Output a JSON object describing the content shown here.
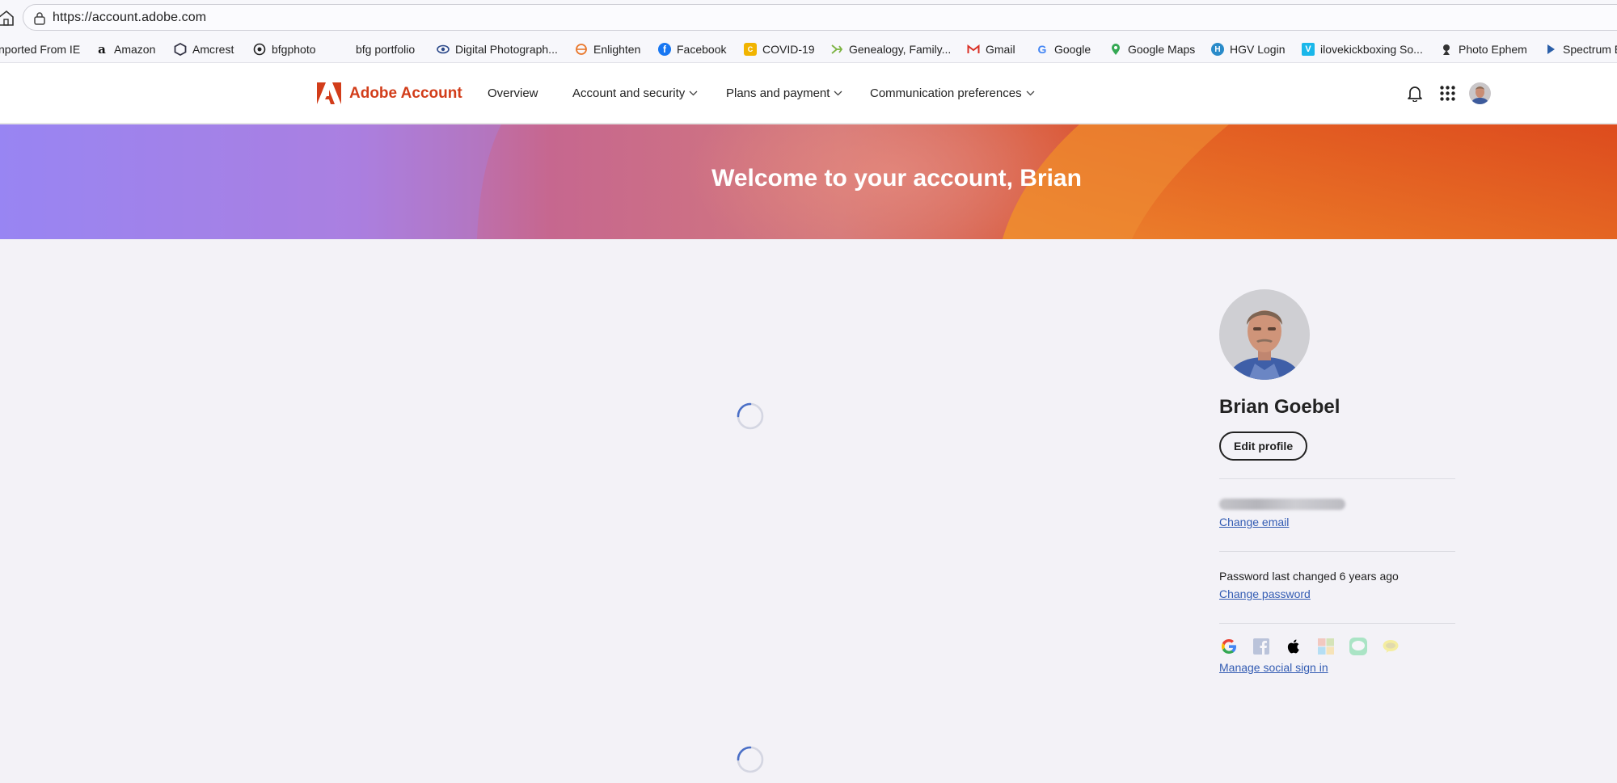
{
  "browser": {
    "url": "https://account.adobe.com",
    "bookmarks": [
      {
        "label": "nported From IE",
        "icon": "none"
      },
      {
        "label": "Amazon",
        "icon": "amazon-icon"
      },
      {
        "label": "Amcrest",
        "icon": "amcrest-icon"
      },
      {
        "label": "bfgphoto",
        "icon": "bfgphoto-icon"
      },
      {
        "label": "bfg portfolio",
        "icon": "none"
      },
      {
        "label": "Digital Photograph...",
        "icon": "eye-icon"
      },
      {
        "label": "Enlighten",
        "icon": "enlighten-icon"
      },
      {
        "label": "Facebook",
        "icon": "facebook-icon"
      },
      {
        "label": "COVID-19",
        "icon": "covid-icon"
      },
      {
        "label": "Genealogy, Family...",
        "icon": "genealogy-icon"
      },
      {
        "label": "Gmail",
        "icon": "gmail-icon"
      },
      {
        "label": "Google",
        "icon": "google-icon"
      },
      {
        "label": "Google Maps",
        "icon": "google-maps-icon"
      },
      {
        "label": "HGV Login",
        "icon": "hgv-icon"
      },
      {
        "label": "ilovekickboxing So...",
        "icon": "vimeo-icon"
      },
      {
        "label": "Photo Ephem",
        "icon": "photo-ephem-icon"
      },
      {
        "label": "Spectrum E",
        "icon": "play-icon"
      }
    ]
  },
  "nav": {
    "brand": "Adobe Account",
    "links": [
      "Overview",
      "Account and security",
      "Plans and payment",
      "Communication preferences"
    ]
  },
  "hero": {
    "title": "Welcome to your account, Brian"
  },
  "profile": {
    "name": "Brian Goebel",
    "edit_label": "Edit profile",
    "change_email_label": "Change email",
    "password_text": "Password last changed 6 years ago",
    "change_password_label": "Change password",
    "social_icons": [
      "google-icon",
      "facebook-icon",
      "apple-icon",
      "microsoft-icon",
      "line-icon",
      "kakao-icon"
    ],
    "manage_social_label": "Manage social sign in"
  },
  "colors": {
    "brand_red": "#d23d1a",
    "link_blue": "#335cb3",
    "page_bg": "#f3f2f7",
    "spinner_blue": "#4a6fc7"
  }
}
